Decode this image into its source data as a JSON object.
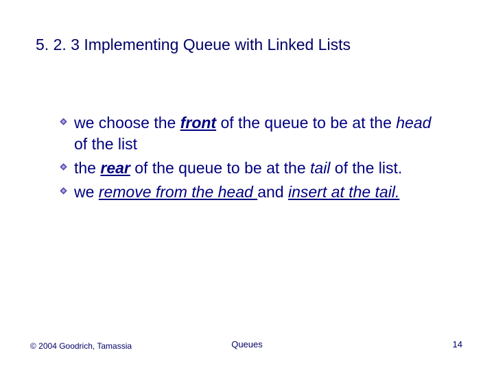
{
  "title": "5. 2. 3 Implementing Queue with Linked Lists",
  "bullets": {
    "b1": {
      "t1": "we choose the ",
      "t2": "front",
      "t3": " of the queue to be at the ",
      "t4": "head",
      "t5": " of the list"
    },
    "b2": {
      "t1": "the ",
      "t2": "rear",
      "t3": " of the queue to be at the ",
      "t4": "tail",
      "t5": " of the list."
    },
    "b3": {
      "t1": "we ",
      "t2": "remove from the head ",
      "t3": "and ",
      "t4": "insert at the tail."
    }
  },
  "footer": {
    "copyright": "© 2004 Goodrich, Tamassia",
    "center": "Queues",
    "page": "14"
  }
}
